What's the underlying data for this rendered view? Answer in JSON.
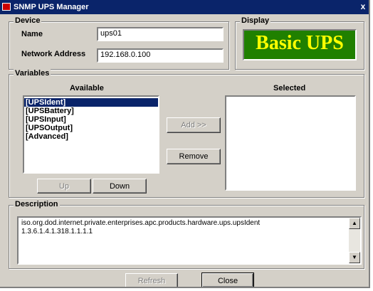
{
  "window": {
    "title": "SNMP UPS Manager",
    "close_glyph": "x"
  },
  "device": {
    "group_label": "Device",
    "name_label": "Name",
    "name_value": "ups01",
    "address_label": "Network Address",
    "address_value": "192.168.0.100"
  },
  "display": {
    "group_label": "Display",
    "text": "Basic UPS"
  },
  "variables": {
    "group_label": "Variables",
    "available_header": "Available",
    "selected_header": "Selected",
    "available_items": [
      {
        "label": "[UPSIdent]",
        "selected": true
      },
      {
        "label": "[UPSBattery]",
        "selected": false
      },
      {
        "label": "[UPSInput]",
        "selected": false
      },
      {
        "label": "[UPSOutput]",
        "selected": false
      },
      {
        "label": "[Advanced]",
        "selected": false
      }
    ],
    "selected_items": [],
    "add_button": "Add >>",
    "remove_button": "Remove",
    "up_button": "Up",
    "down_button": "Down"
  },
  "description": {
    "group_label": "Description",
    "line1": "iso.org.dod.internet.private.enterprises.apc.products.hardware.ups.upsIdent",
    "line2": "1.3.6.1.4.1.318.1.1.1.1",
    "scroll_up_glyph": "▲",
    "scroll_down_glyph": "▼"
  },
  "footer": {
    "refresh_button": "Refresh",
    "close_button": "Close"
  },
  "colors": {
    "titlebar": "#0a246a",
    "display_bg": "#208000",
    "display_text": "#ffff00"
  }
}
